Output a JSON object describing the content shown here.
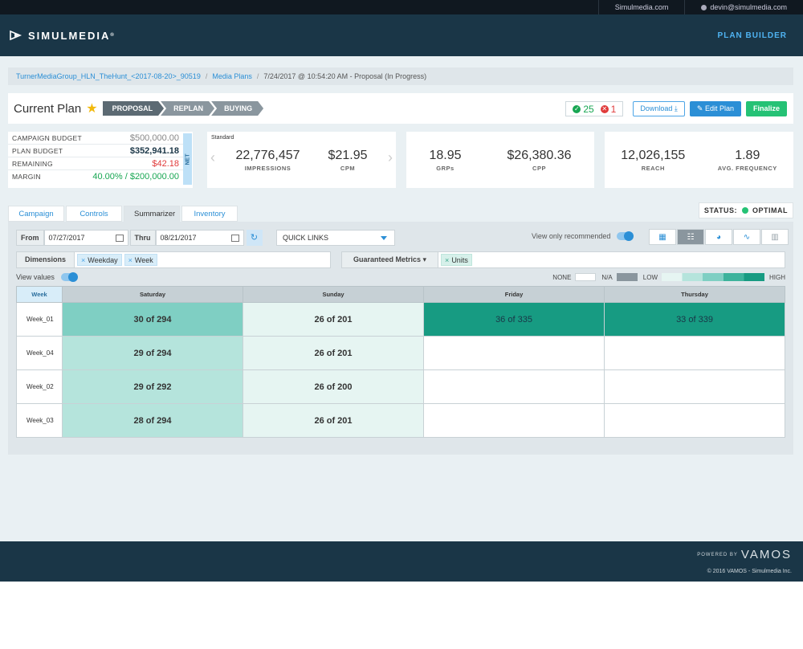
{
  "topbar": {
    "site_link": "Simulmedia.com",
    "user_email": "devin@simulmedia.com"
  },
  "header": {
    "logo_text": "SIMULMEDIA",
    "logo_reg": "®",
    "nav_label": "PLAN BUILDER"
  },
  "breadcrumb": {
    "campaign": "TurnerMediaGroup_HLN_TheHunt_<2017-08-20>_90519",
    "sep": "/",
    "media_plans": "Media Plans",
    "current": "7/24/2017 @ 10:54:20 AM - Proposal (In Progress)"
  },
  "plan": {
    "title": "Current Plan",
    "star_icon": "star-icon",
    "steps": [
      "PROPOSAL",
      "REPLAN",
      "BUYING"
    ],
    "ok_count": "25",
    "err_count": "1",
    "download_label": "Download",
    "edit_label": "Edit Plan",
    "finalize_label": "Finalize"
  },
  "budget": {
    "rows": [
      {
        "label": "CAMPAIGN BUDGET",
        "value": "$500,000.00",
        "color": "#888888"
      },
      {
        "label": "PLAN BUDGET",
        "value": "$352,941.18",
        "color": "#1a3647"
      },
      {
        "label": "REMAINING",
        "value": "$42.18",
        "color": "#e03a3a"
      },
      {
        "label": "MARGIN",
        "value": "40.00% / $200,000.00",
        "color": "#17a652"
      }
    ],
    "net_label": "NET"
  },
  "metrics1": {
    "label": "Standard",
    "impressions": "22,776,457",
    "impressions_label": "IMPRESSIONS",
    "cpm": "$21.95",
    "cpm_label": "CPM"
  },
  "metrics2": {
    "grps": "18.95",
    "grps_label": "GRPs",
    "cpp": "$26,380.36",
    "cpp_label": "CPP"
  },
  "metrics3": {
    "reach": "12,026,155",
    "reach_label": "REACH",
    "freq": "1.89",
    "freq_label": "AVG. FREQUENCY"
  },
  "tabs": [
    "Campaign",
    "Controls",
    "Summarizer",
    "Inventory"
  ],
  "status": {
    "label": "STATUS:",
    "value": "OPTIMAL"
  },
  "filters": {
    "from_label": "From",
    "from_value": "07/27/2017",
    "thru_label": "Thru",
    "thru_value": "08/21/2017",
    "quick_links": "QUICK LINKS",
    "recommend_label": "View only recommended",
    "dimensions_label": "Dimensions",
    "dimensions": [
      "Weekday",
      "Week"
    ],
    "gm_label": "Guaranteed Metrics ▾",
    "gm_chips": [
      "Units"
    ],
    "view_values_label": "View values"
  },
  "legend": {
    "none": "NONE",
    "na": "N/A",
    "low": "LOW",
    "high": "HIGH"
  },
  "grid": {
    "corner": "Week",
    "columns": [
      "Saturday",
      "Sunday",
      "Friday",
      "Thursday"
    ],
    "rows": [
      {
        "week": "Week_01",
        "cells": [
          "30 of 294",
          "26 of 201",
          "36 of 335",
          "33 of 339"
        ],
        "colors": [
          "#7fcfc3",
          "#e6f5f2",
          "#179b82",
          "#179b82"
        ]
      },
      {
        "week": "Week_04",
        "cells": [
          "29 of 294",
          "26 of 201",
          "",
          ""
        ],
        "colors": [
          "#b5e4dc",
          "#e6f5f2",
          "#ffffff",
          "#ffffff"
        ]
      },
      {
        "week": "Week_02",
        "cells": [
          "29 of 292",
          "26 of 200",
          "",
          ""
        ],
        "colors": [
          "#b5e4dc",
          "#e6f5f2",
          "#ffffff",
          "#ffffff"
        ]
      },
      {
        "week": "Week_03",
        "cells": [
          "28 of 294",
          "26 of 201",
          "",
          ""
        ],
        "colors": [
          "#b5e4dc",
          "#e6f5f2",
          "#ffffff",
          "#ffffff"
        ]
      }
    ]
  },
  "footer": {
    "powered_by": "POWERED BY",
    "brand": "VAMOS",
    "copyright": "© 2016 VAMOS - Simulmedia Inc."
  }
}
